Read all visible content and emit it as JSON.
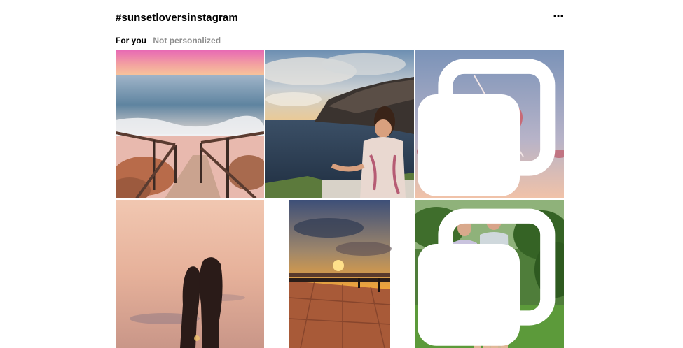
{
  "header": {
    "hashtag": "#sunsetloversinstagram",
    "more_icon": "more-horizontal-icon"
  },
  "tabs": [
    {
      "label": "For you",
      "active": true
    },
    {
      "label": "Not personalized",
      "active": false
    }
  ],
  "grid": {
    "posts": [
      {
        "image": "pink-sunset-beach-stairs",
        "multi": false
      },
      {
        "image": "woman-on-cliff-overlooking-sea",
        "multi": false
      },
      {
        "image": "heart-shaped-cloud-sky",
        "multi": true
      },
      {
        "image": "feet-silhouette-against-sunset",
        "multi": false
      },
      {
        "image": "orange-sunset-promenade",
        "multi": false
      },
      {
        "image": "family-in-tropical-garden",
        "multi": true
      }
    ]
  },
  "colors": {
    "text_primary": "#000000",
    "text_secondary": "#8e8e8e",
    "background": "#ffffff"
  }
}
